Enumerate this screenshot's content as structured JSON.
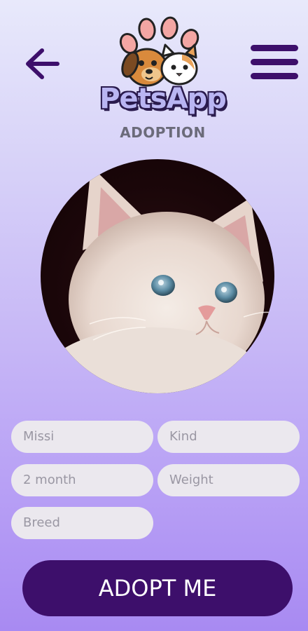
{
  "header": {
    "back_icon": "arrow-left-icon",
    "menu_icon": "hamburger-menu-icon",
    "logo_text": "PetsApp",
    "logo_subtitle": "ADOPTION",
    "accent_color": "#3d0f6b"
  },
  "pet_photo": {
    "icon": "kitten-photo"
  },
  "form": {
    "name_value": "Missi",
    "kind_placeholder": "Kind",
    "age_value": "2 month",
    "weight_placeholder": "Weight",
    "breed_placeholder": "Breed"
  },
  "actions": {
    "adopt_label": "ADOPT ME"
  }
}
